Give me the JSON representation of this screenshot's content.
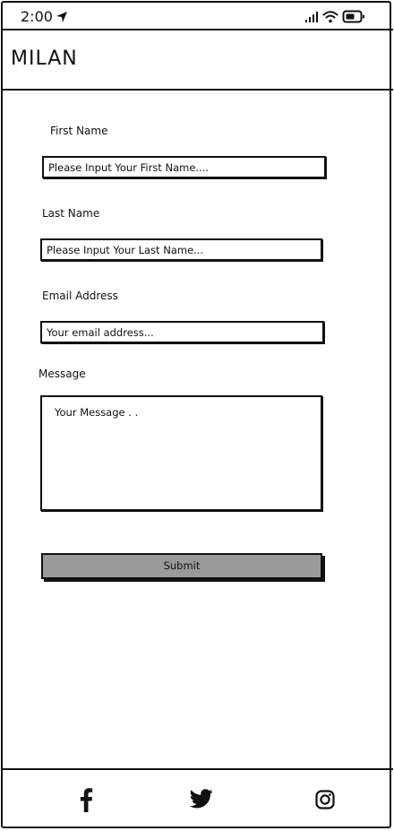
{
  "status_bar": {
    "time": "2:00",
    "icons": [
      "location-arrow-icon",
      "signal-icon",
      "wifi-icon",
      "battery-icon"
    ]
  },
  "header": {
    "title": "MILAN"
  },
  "form": {
    "first_name": {
      "label": "First Name",
      "placeholder": "Please Input Your First Name...."
    },
    "last_name": {
      "label": "Last Name",
      "placeholder": "Please Input Your Last Name..."
    },
    "email": {
      "label": "Email Address",
      "placeholder": "Your email address..."
    },
    "message": {
      "label": "Message",
      "placeholder": "Your Message . ."
    },
    "submit_label": "Submit"
  },
  "bottom_nav": {
    "icons": [
      "facebook-icon",
      "twitter-icon",
      "instagram-icon"
    ]
  },
  "colors": {
    "border": "#111111",
    "button_fill": "#9a9a9a",
    "background": "#ffffff"
  }
}
